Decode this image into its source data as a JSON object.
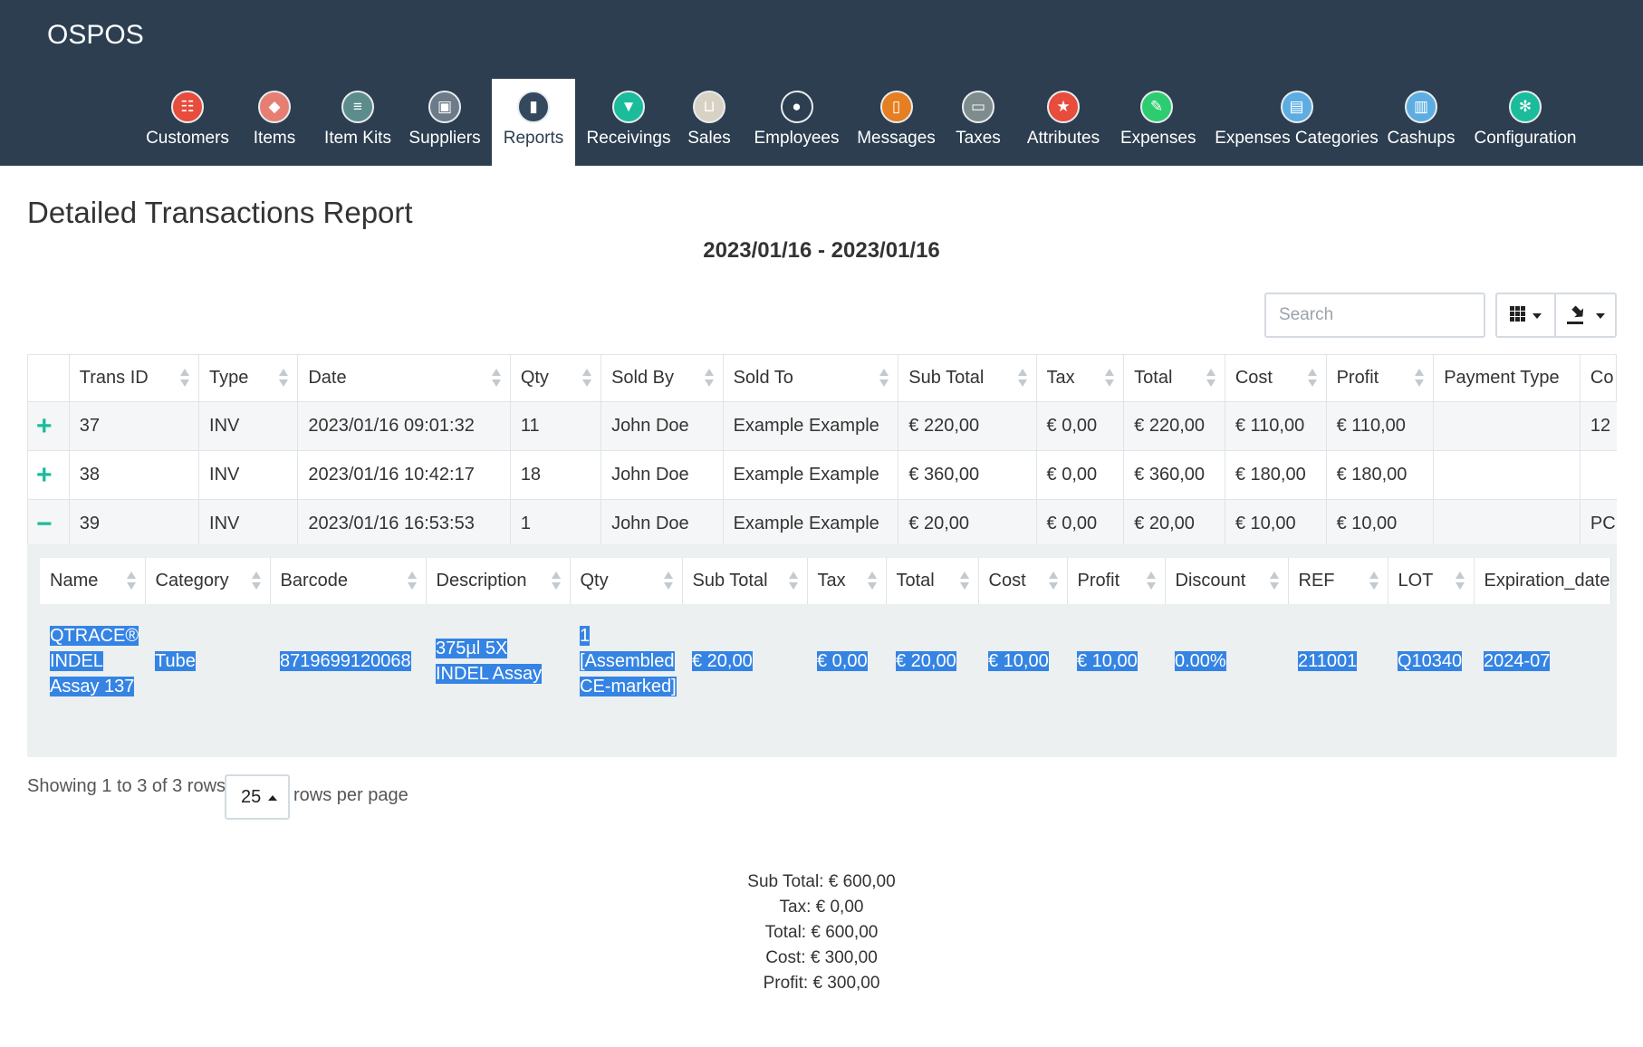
{
  "app": {
    "brand": "OSPOS"
  },
  "nav": [
    {
      "label": "Customers",
      "icon": "customers-icon",
      "color": "#e74c3c",
      "glyph": "☷"
    },
    {
      "label": "Items",
      "icon": "items-icon",
      "color": "#e67e73",
      "glyph": "◆"
    },
    {
      "label": "Item Kits",
      "icon": "item-kits-icon",
      "color": "#5d8c8c",
      "glyph": "≡"
    },
    {
      "label": "Suppliers",
      "icon": "suppliers-icon",
      "color": "#6c7a89",
      "glyph": "▣"
    },
    {
      "label": "Reports",
      "icon": "reports-icon",
      "color": "#34495e",
      "glyph": "▮"
    },
    {
      "label": "Receivings",
      "icon": "receivings-icon",
      "color": "#1abc9c",
      "glyph": "▼"
    },
    {
      "label": "Sales",
      "icon": "sales-icon",
      "color": "#d8d2c4",
      "glyph": "⊔"
    },
    {
      "label": "Employees",
      "icon": "employees-icon",
      "color": "#2c3e50",
      "glyph": "●"
    },
    {
      "label": "Messages",
      "icon": "messages-icon",
      "color": "#e67e22",
      "glyph": "▯"
    },
    {
      "label": "Taxes",
      "icon": "taxes-icon",
      "color": "#7f8c8d",
      "glyph": "▭"
    },
    {
      "label": "Attributes",
      "icon": "attributes-icon",
      "color": "#e74c3c",
      "glyph": "★"
    },
    {
      "label": "Expenses",
      "icon": "expenses-icon",
      "color": "#2ecc71",
      "glyph": "✎"
    },
    {
      "label": "Expenses Categories",
      "icon": "expenses-categories-icon",
      "color": "#5dade2",
      "glyph": "▤"
    },
    {
      "label": "Cashups",
      "icon": "cashups-icon",
      "color": "#5dade2",
      "glyph": "▥"
    },
    {
      "label": "Configuration",
      "icon": "configuration-icon",
      "color": "#1abc9c",
      "glyph": "✻"
    }
  ],
  "report": {
    "title": "Detailed Transactions Report",
    "date_range": "2023/01/16 - 2023/01/16"
  },
  "toolbar": {
    "search_placeholder": "Search",
    "columns_icon": "columns-icon",
    "export_icon": "export-icon"
  },
  "table": {
    "columns": [
      "",
      "Trans ID",
      "Type",
      "Date",
      "Qty",
      "Sold By",
      "Sold To",
      "Sub Total",
      "Tax",
      "Total",
      "Cost",
      "Profit",
      "Payment Type",
      "Co"
    ],
    "rows": [
      {
        "expander": "+",
        "cells": [
          "37",
          "INV",
          "2023/01/16 09:01:32",
          "11",
          "John Doe",
          "Example Example",
          "€ 220,00",
          "€ 0,00",
          "€ 220,00",
          "€ 110,00",
          "€ 110,00",
          "",
          "12"
        ]
      },
      {
        "expander": "+",
        "cells": [
          "38",
          "INV",
          "2023/01/16 10:42:17",
          "18",
          "John Doe",
          "Example Example",
          "€ 360,00",
          "€ 0,00",
          "€ 360,00",
          "€ 180,00",
          "€ 180,00",
          "",
          ""
        ]
      },
      {
        "expander": "−",
        "cells": [
          "39",
          "INV",
          "2023/01/16 16:53:53",
          "1",
          "John Doe",
          "Example Example",
          "€ 20,00",
          "€ 0,00",
          "€ 20,00",
          "€ 10,00",
          "€ 10,00",
          "",
          "PC"
        ]
      }
    ]
  },
  "detail": {
    "columns": [
      "Name",
      "Category",
      "Barcode",
      "Description",
      "Qty",
      "Sub Total",
      "Tax",
      "Total",
      "Cost",
      "Profit",
      "Discount",
      "REF",
      "LOT",
      "Expiration_date"
    ],
    "row": [
      "QTRACE® INDEL Assay 137",
      "Tube",
      "8719699120068",
      "375µl 5X INDEL Assay",
      "1 [Assembled CE-marked]",
      "€ 20,00",
      "€ 0,00",
      "€ 20,00",
      "€ 10,00",
      "€ 10,00",
      "0.00%",
      "211001",
      "Q10340",
      "2024-07"
    ]
  },
  "pagination": {
    "showing": "Showing 1 to 3 of 3 rows",
    "page_size": "25",
    "rows_per_page": "rows per page"
  },
  "summary": {
    "sub_total": "Sub Total: € 600,00",
    "tax": "Tax: € 0,00",
    "total": "Total: € 600,00",
    "cost": "Cost: € 300,00",
    "profit": "Profit: € 300,00"
  }
}
